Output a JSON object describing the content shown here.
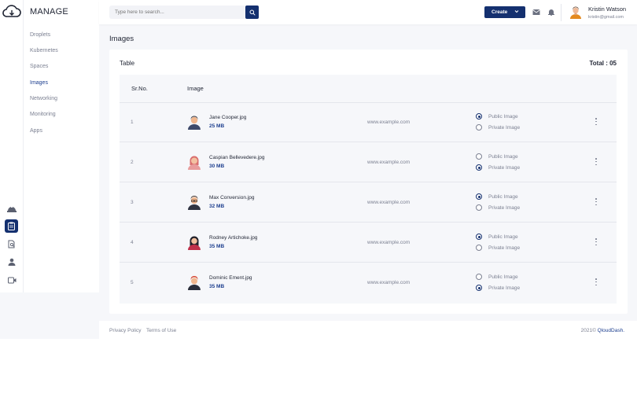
{
  "sidebar": {
    "title": "MANAGE",
    "items": [
      {
        "label": "Droplets",
        "active": false
      },
      {
        "label": "Kubernetes",
        "active": false
      },
      {
        "label": "Spaces",
        "active": false
      },
      {
        "label": "Images",
        "active": true
      },
      {
        "label": "Networking",
        "active": false
      },
      {
        "label": "Monitoring",
        "active": false
      },
      {
        "label": "Apps",
        "active": false
      }
    ],
    "rail_icons": [
      "cloud-logo-icon",
      "helmet-icon",
      "clipboard-icon",
      "document-search-icon",
      "user-icon",
      "video-icon"
    ]
  },
  "header": {
    "search_placeholder": "Type here to search...",
    "create_label": "Create",
    "user_name": "Kristin Watson",
    "user_email": "kristin@gmail.com"
  },
  "page": {
    "title": "Images",
    "card_label": "Table",
    "total": "Total : 05"
  },
  "table": {
    "columns": [
      "Sr.No.",
      "Image"
    ],
    "rows": [
      {
        "no": "1",
        "name": "Jane Cooper.jpg",
        "size": "25 MB",
        "url": "www.example.com",
        "public_label": "Public Image",
        "private_label": "Private Image",
        "selected": "public",
        "avatar": "man-icon"
      },
      {
        "no": "2",
        "name": "Caspian Bellevedere.jpg",
        "size": "30 MB",
        "url": "www.example.com",
        "public_label": "Public Image",
        "private_label": "Private Image",
        "selected": "private",
        "avatar": "woman-icon"
      },
      {
        "no": "3",
        "name": "Max Conversion.jpg",
        "size": "32 MB",
        "url": "www.example.com",
        "public_label": "Public Image",
        "private_label": "Private Image",
        "selected": "public",
        "avatar": "man-glasses-icon"
      },
      {
        "no": "4",
        "name": "Rodney Artichoke.jpg",
        "size": "35 MB",
        "url": "www.example.com",
        "public_label": "Public Image",
        "private_label": "Private Image",
        "selected": "public",
        "avatar": "woman-dark-hair-icon"
      },
      {
        "no": "5",
        "name": "Dominic Ement.jpg",
        "size": "35 MB",
        "url": "www.example.com",
        "public_label": "Public Image",
        "private_label": "Private Image",
        "selected": "private",
        "avatar": "man-red-hair-icon"
      }
    ]
  },
  "footer": {
    "privacy": "Privacy Policy",
    "terms": "Terms of Use",
    "copyright": "2021©",
    "brand": "QloudDash."
  },
  "colors": {
    "accent": "#14306f",
    "link": "#1d3f8f",
    "muted": "#7c8192",
    "background": "#f6f7fa"
  }
}
